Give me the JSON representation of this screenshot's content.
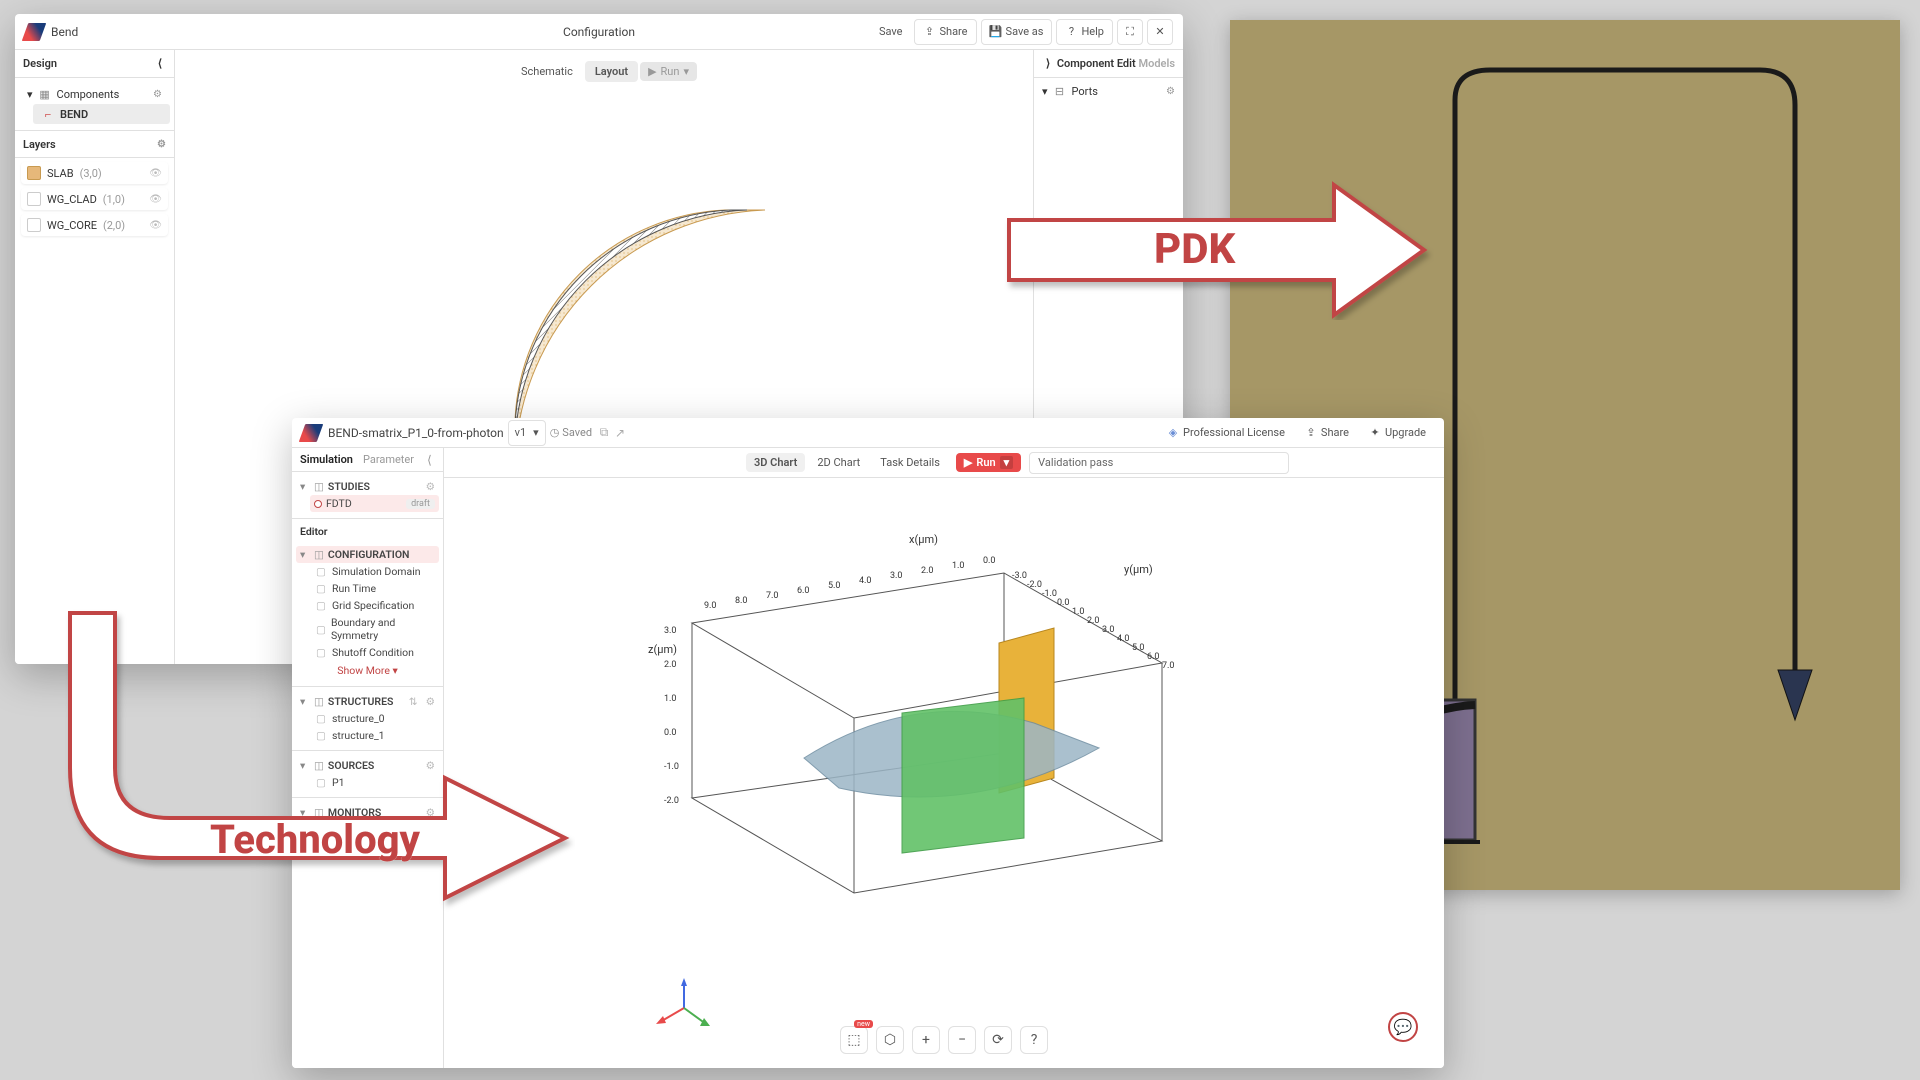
{
  "callouts": {
    "technology": "Technology",
    "pdk": "PDK"
  },
  "winA": {
    "title": "Bend",
    "center": "Configuration",
    "actions": {
      "save": "Save",
      "share": "Share",
      "save_as": "Save as",
      "help": "Help"
    },
    "left": {
      "design_label": "Design",
      "components_label": "Components",
      "bend_item": "BEND",
      "layers_label": "Layers",
      "layers": [
        {
          "name": "SLAB",
          "tag": "(3,0)",
          "color": "#e6b87a",
          "fill": true
        },
        {
          "name": "WG_CLAD",
          "tag": "(1,0)",
          "color": "#ffffff",
          "fill": false
        },
        {
          "name": "WG_CORE",
          "tag": "(2,0)",
          "color": "#ffffff",
          "fill": false
        }
      ]
    },
    "view_tabs": {
      "schematic": "Schematic",
      "layout": "Layout",
      "run": "Run"
    },
    "right": {
      "component_edit": "Component Edit",
      "models": "Models",
      "ports": "Ports"
    }
  },
  "winB": {
    "title": "BEND-smatrix_P1_0-from-photon",
    "version": "v1",
    "status": "Saved",
    "actions": {
      "license": "Professional License",
      "share": "Share",
      "upgrade": "Upgrade"
    },
    "left": {
      "sim_tab": "Simulation",
      "param_tab": "Parameter",
      "editor_label": "Editor",
      "show_more": "Show More",
      "sections": {
        "studies": "STUDIES",
        "fdtd": "FDTD",
        "fdtd_badge": "draft",
        "config": "CONFIGURATION",
        "config_items": [
          "Simulation Domain",
          "Run Time",
          "Grid Specification",
          "Boundary and Symmetry",
          "Shutoff Condition"
        ],
        "structures": "STRUCTURES",
        "struct_items": [
          "structure_0",
          "structure_1"
        ],
        "sources": "SOURCES",
        "source_items": [
          "P1"
        ],
        "monitors": "MONITORS"
      }
    },
    "toolbar": {
      "chart3d": "3D Chart",
      "chart2d": "2D Chart",
      "task": "Task Details",
      "run": "Run",
      "validation": "Validation pass",
      "new": "new"
    },
    "viewport": {
      "x_label": "x(µm)",
      "y_label": "y(µm)",
      "z_label": "z(µm)",
      "x_ticks": [
        "9.0",
        "8.0",
        "7.0",
        "6.0",
        "5.0",
        "4.0",
        "3.0",
        "2.0",
        "1.0",
        "0.0"
      ],
      "y_ticks": [
        "-3.0",
        "-2.0",
        "-1.0",
        "0.0",
        "1.0",
        "2.0",
        "3.0",
        "4.0",
        "5.0",
        "6.0",
        "7.0"
      ],
      "z_ticks": [
        "3.0",
        "2.0",
        "1.0",
        "0.0",
        "-1.0",
        "-2.0"
      ]
    }
  }
}
